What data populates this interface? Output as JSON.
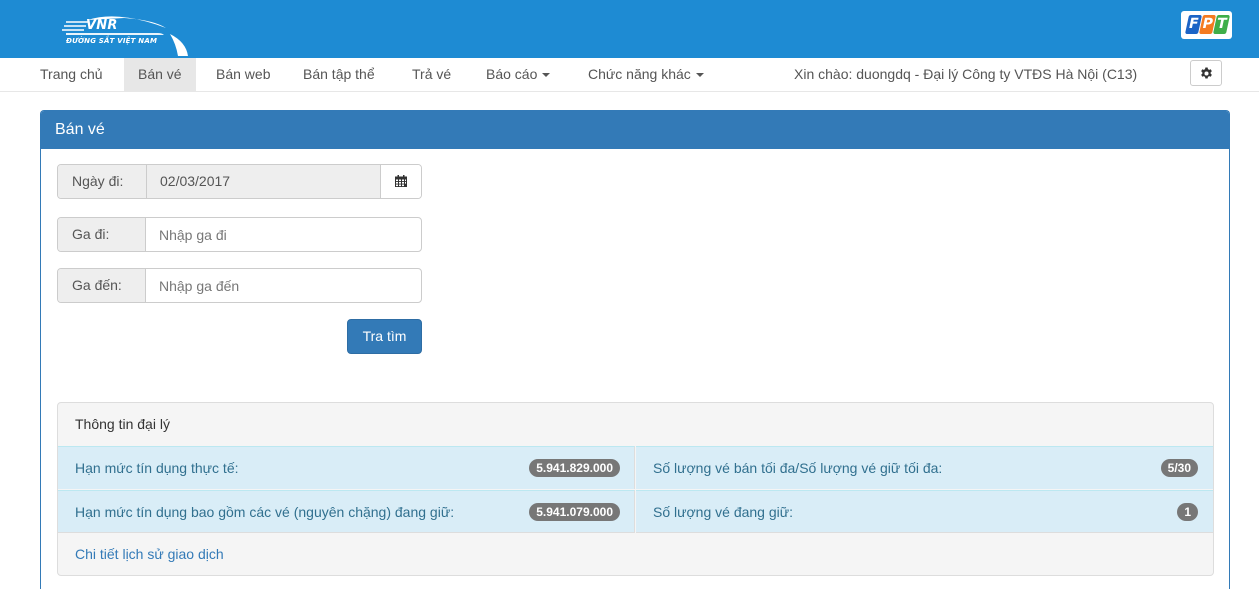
{
  "app": {
    "logo_text": "VNR",
    "logo_subtitle": "ĐƯỜNG SẮT VIỆT NAM",
    "partner_logo": "FPT"
  },
  "nav": {
    "items": [
      {
        "label": "Trang chủ"
      },
      {
        "label": "Bán vé",
        "active": true
      },
      {
        "label": "Bán web"
      },
      {
        "label": "Bán tập thể"
      },
      {
        "label": "Trả vé"
      },
      {
        "label": "Báo cáo",
        "dropdown": true
      },
      {
        "label": "Chức năng khác",
        "dropdown": true
      }
    ],
    "greeting": "Xin chào: duongdq - Đại lý Công ty VTĐS Hà Nội (C13)",
    "settings_icon": "gear-icon"
  },
  "panel": {
    "title": "Bán vé"
  },
  "form": {
    "date_label": "Ngày đi:",
    "date_value": "02/03/2017",
    "calendar_icon": "calendar-icon",
    "from_label": "Ga đi:",
    "from_placeholder": "Nhập ga đi",
    "from_value": "",
    "to_label": "Ga đến:",
    "to_placeholder": "Nhập ga đến",
    "to_value": "",
    "search_label": "Tra tìm"
  },
  "agent_info": {
    "title": "Thông tin đại lý",
    "rows": [
      {
        "label": "Hạn mức tín dụng thực tế:",
        "value": "5.941.829.000"
      },
      {
        "label": "Số lượng vé bán tối đa/Số lượng vé giữ tối đa:",
        "value": "5/30"
      },
      {
        "label": "Hạn mức tín dụng bao gồm các vé (nguyên chặng) đang giữ:",
        "value": "5.941.079.000"
      },
      {
        "label": "Số lượng vé đang giữ:",
        "value": "1"
      }
    ],
    "history_link": "Chi tiết lịch sử giao dịch"
  },
  "colors": {
    "banner": "#1e8bd3",
    "primary": "#337ab7",
    "info_bg": "#d9edf7",
    "info_text": "#31708f",
    "badge": "#777777"
  }
}
